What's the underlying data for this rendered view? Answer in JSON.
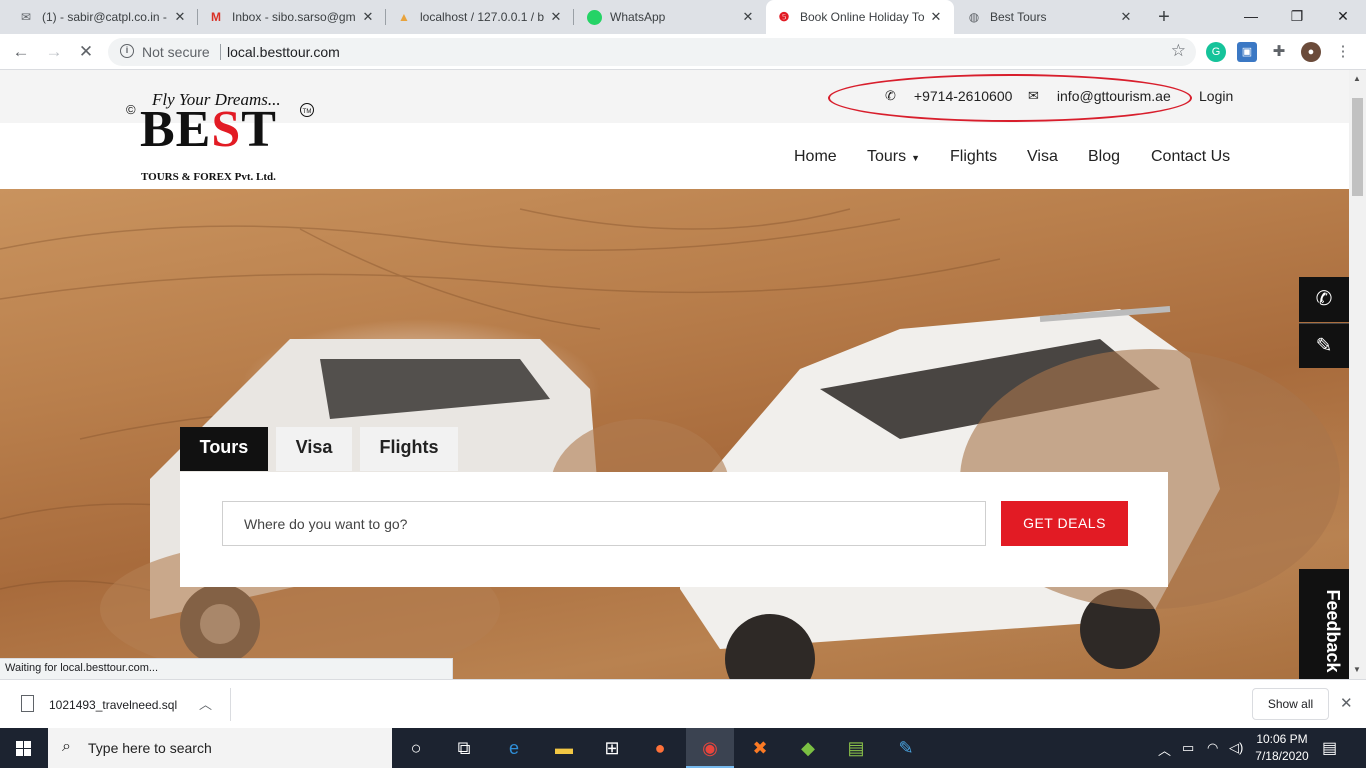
{
  "browser": {
    "tabs": [
      {
        "title": "(1) - sabir@catpl.co.in -",
        "icon": "mail-icon"
      },
      {
        "title": "Inbox - sibo.sarso@gm",
        "icon": "gmail-icon"
      },
      {
        "title": "localhost / 127.0.0.1 / b",
        "icon": "phpmyadmin-icon"
      },
      {
        "title": "WhatsApp",
        "icon": "whatsapp-icon"
      },
      {
        "title": "Book Online Holiday To",
        "icon": "site-icon"
      },
      {
        "title": "Best Tours",
        "icon": "globe-icon"
      }
    ],
    "omnibox": {
      "security": "Not secure",
      "url": "local.besttour.com"
    },
    "status_text": "Waiting for local.besttour.com..."
  },
  "site": {
    "phone": "+9714-2610600",
    "email": "info@gttourism.ae",
    "login": "Login",
    "logo": {
      "tagline": "Fly Your Dreams...",
      "brand_left": "BE",
      "brand_s": "S",
      "brand_right": "T",
      "sub": "TOURS & FOREX Pvt. Ltd.",
      "copyright": "©",
      "tm": "TM"
    },
    "nav": [
      {
        "label": "Home"
      },
      {
        "label": "Tours"
      },
      {
        "label": "Flights"
      },
      {
        "label": "Visa"
      },
      {
        "label": "Blog"
      },
      {
        "label": "Contact Us"
      }
    ],
    "search": {
      "tabs": [
        "Tours",
        "Visa",
        "Flights"
      ],
      "placeholder": "Where do you want to go?",
      "button": "GET DEALS"
    },
    "feedback": "Feedback"
  },
  "downloads": {
    "file": "1021493_travelneed.sql",
    "show_all": "Show all"
  },
  "taskbar": {
    "search_placeholder": "Type here to search",
    "time": "10:06 PM",
    "date": "7/18/2020"
  },
  "colors": {
    "accent_red": "#e21b24",
    "dark": "#111111"
  }
}
